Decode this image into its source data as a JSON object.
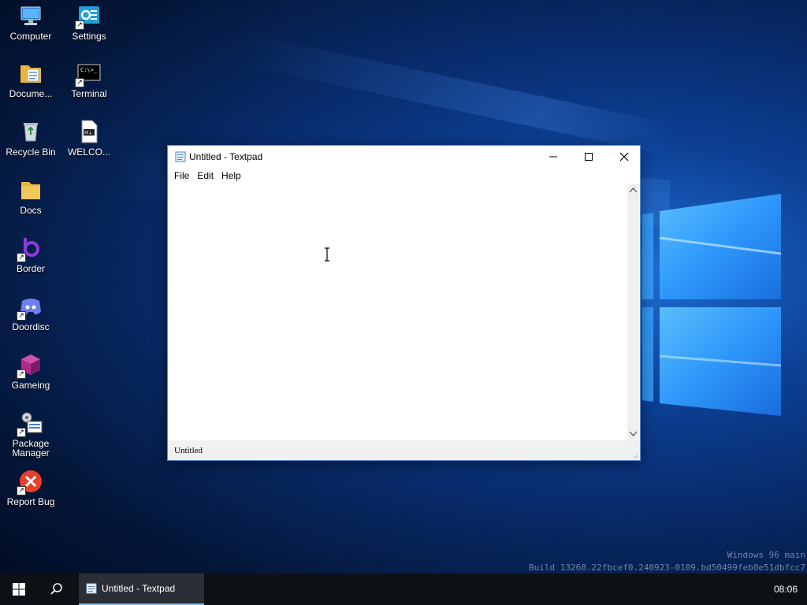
{
  "desktop": {
    "icons": [
      {
        "label": "Computer"
      },
      {
        "label": "Settings"
      },
      {
        "label": "Docume..."
      },
      {
        "label": "Terminal"
      },
      {
        "label": "Recycle Bin"
      },
      {
        "label": "WELCO..."
      },
      {
        "label": "Docs"
      },
      {
        "label": "Border"
      },
      {
        "label": "Doordisc"
      },
      {
        "label": "Gameing"
      },
      {
        "label": "Package Manager"
      },
      {
        "label": "Report Bug"
      }
    ]
  },
  "window": {
    "title": "Untitled - Textpad",
    "menu": [
      "File",
      "Edit",
      "Help"
    ],
    "editor_text": "",
    "status_text": "Untitled"
  },
  "watermark": {
    "line1": "Windows 96 main",
    "line2": "Build 13268.22fbcef0.240923-0109.bd50499feb0e51dbfcc7"
  },
  "taskbar": {
    "task_label": "Untitled - Textpad",
    "clock": "08:06"
  },
  "colors": {
    "accent": "#76b9ed",
    "taskbar": "#0d1116",
    "window_border": "#5a8ed0"
  }
}
